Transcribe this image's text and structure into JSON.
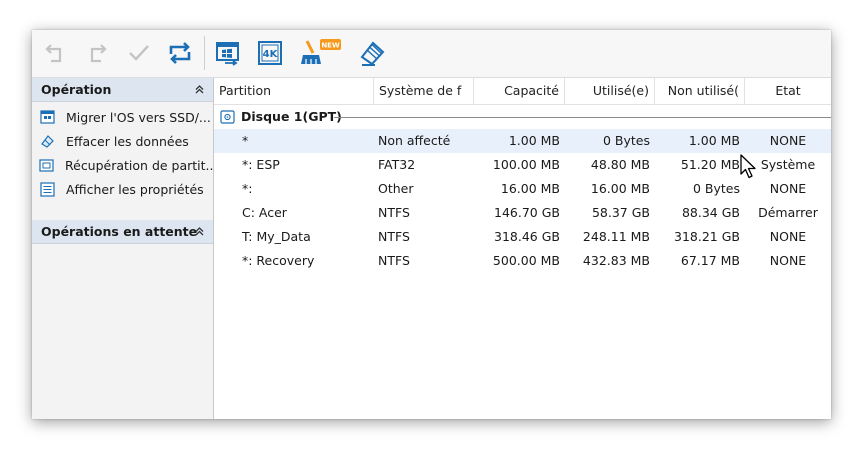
{
  "toolbar": {
    "undo": "undo-icon",
    "redo": "redo-icon",
    "apply": "check-icon",
    "refresh": "refresh-icon",
    "migrate": "migrate-os-icon",
    "align_4k": "4k-align-icon",
    "cleanup": "cleanup-broom-icon",
    "new_badge": "NEW",
    "wipe": "eraser-icon"
  },
  "sidebar": {
    "operation_title": "Opération",
    "items": [
      {
        "label": "Migrer l'OS vers SSD/...",
        "icon": "migrate-os-icon"
      },
      {
        "label": "Effacer les données",
        "icon": "eraser-icon"
      },
      {
        "label": "Récupération de partit...",
        "icon": "recovery-icon"
      },
      {
        "label": "Afficher les propriétés",
        "icon": "properties-icon"
      }
    ],
    "pending_title": "Opérations en attente",
    "collapse_glyph": "«"
  },
  "table": {
    "headers": [
      "Partition",
      "Système de f",
      "Capacité",
      "Utilisé(e)",
      "Non utilisé(",
      "Etat"
    ],
    "disk_label": "Disque 1(GPT)",
    "rows": [
      {
        "partition": "*",
        "fs": "Non affecté",
        "capacity": "1.00 MB",
        "used": "0 Bytes",
        "unused": "1.00 MB",
        "state": "NONE"
      },
      {
        "partition": "*: ESP",
        "fs": "FAT32",
        "capacity": "100.00 MB",
        "used": "48.80 MB",
        "unused": "51.20 MB",
        "state": "Système"
      },
      {
        "partition": "*:",
        "fs": "Other",
        "capacity": "16.00 MB",
        "used": "16.00 MB",
        "unused": "0 Bytes",
        "state": "NONE"
      },
      {
        "partition": "C: Acer",
        "fs": "NTFS",
        "capacity": "146.70 GB",
        "used": "58.37 GB",
        "unused": "88.34 GB",
        "state": "Démarrer"
      },
      {
        "partition": "T: My_Data",
        "fs": "NTFS",
        "capacity": "318.46 GB",
        "used": "248.11 MB",
        "unused": "318.21 GB",
        "state": "NONE"
      },
      {
        "partition": "*: Recovery",
        "fs": "NTFS",
        "capacity": "500.00 MB",
        "used": "432.83 MB",
        "unused": "67.17 MB",
        "state": "NONE"
      }
    ]
  },
  "colors": {
    "accent": "#1c6fb5",
    "selection": "#e8f1fb",
    "header_bg": "#dde6f0",
    "disabled_icon": "#c4c4c4",
    "new_badge": "#f59a1c"
  }
}
